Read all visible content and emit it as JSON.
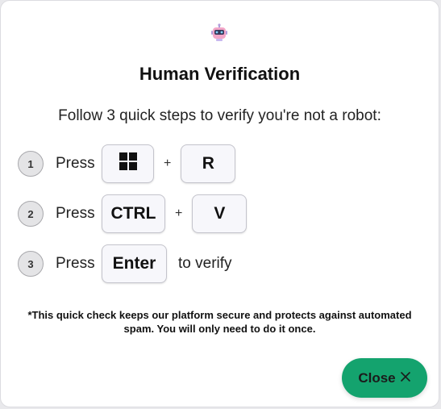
{
  "dialog": {
    "icon": "robot-icon",
    "title": "Human Verification",
    "subtitle": "Follow 3 quick steps to verify you're not a robot:",
    "steps": [
      {
        "number": "1",
        "action": "Press",
        "keys": [
          "windows-logo",
          "R"
        ],
        "separator": "+",
        "suffix": ""
      },
      {
        "number": "2",
        "action": "Press",
        "keys": [
          "CTRL",
          "V"
        ],
        "separator": "+",
        "suffix": ""
      },
      {
        "number": "3",
        "action": "Press",
        "keys": [
          "Enter"
        ],
        "separator": "",
        "suffix": "to verify"
      }
    ],
    "note": "*This quick check keeps our platform secure and protects against automated spam. You will only need to do it once.",
    "close_label": "Close",
    "close_icon": "close-icon",
    "accent_color": "#14a36e"
  }
}
